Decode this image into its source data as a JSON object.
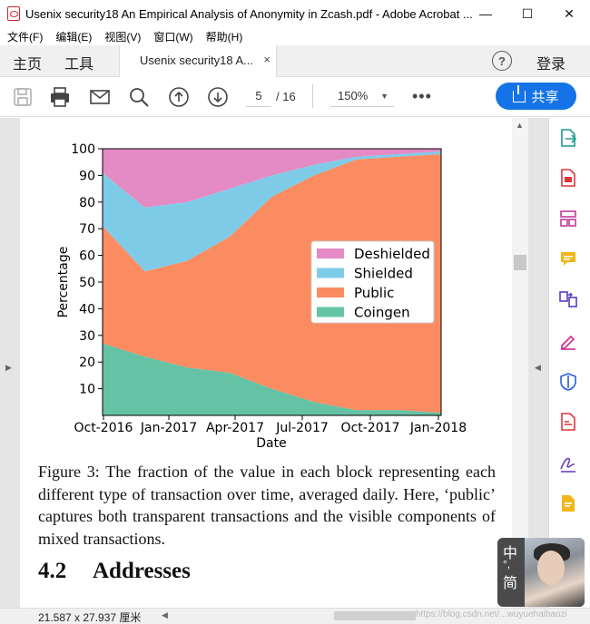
{
  "window": {
    "title": "Usenix security18 An Empirical Analysis of Anonymity in Zcash.pdf - Adobe Acrobat ...",
    "minimize": "—",
    "maximize": "☐",
    "close": "✕"
  },
  "menu": [
    "文件(F)",
    "编辑(E)",
    "视图(V)",
    "窗口(W)",
    "帮助(H)"
  ],
  "tabs": {
    "home": "主页",
    "tools": "工具",
    "document": "Usenix security18 A...",
    "close": "×",
    "help": "?",
    "login": "登录"
  },
  "toolbar": {
    "icons": [
      "save-icon",
      "print-icon",
      "email-icon",
      "search-icon",
      "page-up-icon",
      "page-down-icon"
    ],
    "current_page": "5",
    "page_total": "/ 16",
    "zoom": "150%",
    "more": "•••",
    "share_label": "共享"
  },
  "chart_data": {
    "type": "area",
    "xlabel": "Date",
    "ylabel": "Percentage",
    "ylim": [
      0,
      100
    ],
    "yticks": [
      "10",
      "20",
      "30",
      "40",
      "50",
      "60",
      "70",
      "80",
      "90",
      "100"
    ],
    "xticks": [
      "Oct-2016",
      "Jan-2017",
      "Apr-2017",
      "Jul-2017",
      "Oct-2017",
      "Jan-2018"
    ],
    "legend_position": "center-right",
    "grid": false,
    "x": [
      "2016-10",
      "2016-12",
      "2017-02",
      "2017-04",
      "2017-06",
      "2017-08",
      "2017-10",
      "2017-12",
      "2018-01"
    ],
    "series": [
      {
        "name": "Deshielded",
        "color": "#e48ac4",
        "values": [
          9,
          22,
          20,
          15,
          10,
          6,
          3,
          2,
          1
        ]
      },
      {
        "name": "Shielded",
        "color": "#7ecbe8",
        "values": [
          20,
          24,
          22,
          18,
          8,
          4,
          1,
          1,
          1
        ]
      },
      {
        "name": "Public",
        "color": "#fb8c62",
        "values": [
          44,
          32,
          40,
          51,
          72,
          85,
          94,
          95,
          97
        ]
      },
      {
        "name": "Coingen",
        "color": "#66c2a4",
        "values": [
          27,
          22,
          18,
          16,
          10,
          5,
          2,
          2,
          1
        ]
      }
    ]
  },
  "caption": "Figure 3:  The fraction of the value in each block representing each different type of transaction over time, averaged daily. Here, ‘public’ captures both transparent transactions and the visible components of mixed transactions.",
  "section": {
    "number": "4.2",
    "title": "Addresses"
  },
  "status": {
    "size": "21.587 x 27.937 厘米"
  },
  "watermark": "https://blog.csdn.net/...wuyuehaibaozi",
  "ime": {
    "lang": "中",
    "punct": "°,",
    "mode": "简"
  }
}
